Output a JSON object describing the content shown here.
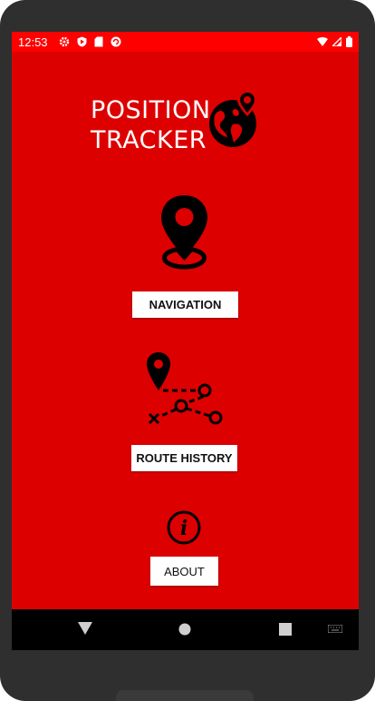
{
  "status_bar": {
    "time": "12:53",
    "left_icons": [
      "gear-icon",
      "play-protect-icon",
      "sim-card-icon",
      "sync-icon"
    ],
    "right_icons": [
      "wifi-icon",
      "signal-icon",
      "battery-icon"
    ]
  },
  "header": {
    "title_line1": "POSITION",
    "title_line2": "TRACKER",
    "logo_icon": "globe-location-icon"
  },
  "main": {
    "navigation_icon": "location-pin-icon",
    "navigation_label": "NAVIGATION",
    "route_icon": "route-path-icon",
    "route_history_label": "ROUTE HISTORY",
    "about_icon": "info-icon",
    "about_label": "ABOUT"
  },
  "system_nav": {
    "buttons": [
      "back-icon",
      "home-icon",
      "recents-icon",
      "keyboard-icon"
    ]
  },
  "colors": {
    "background": "#dd0000",
    "status_bar": "#ff0000",
    "button_bg": "#ffffff",
    "icon": "#000000",
    "device_frame": "#2f2f2f"
  }
}
